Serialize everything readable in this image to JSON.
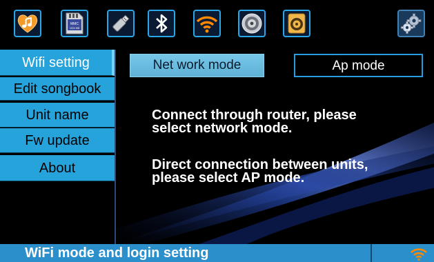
{
  "toolbar": {
    "icons": [
      "music-icon",
      "sd-card-icon",
      "usb-drive-icon",
      "bluetooth-icon",
      "wifi-icon",
      "speaker-icon",
      "sub-speaker-icon",
      "settings-gears-icon"
    ],
    "sd_card_brand": "MMC",
    "sd_card_size": "1024 MB"
  },
  "menu": {
    "items": [
      {
        "label": "Wifi setting",
        "active": true
      },
      {
        "label": "Edit songbook",
        "active": false
      },
      {
        "label": "Unit name",
        "active": false
      },
      {
        "label": "Fw update",
        "active": false
      },
      {
        "label": "About",
        "active": false
      }
    ]
  },
  "tabs": {
    "network_mode": "Net work mode",
    "ap_mode": "Ap mode"
  },
  "content": {
    "router_msg_line1": "Connect through router, please",
    "router_msg_line2": "select network mode.",
    "ap_msg_line1": "Direct connection between units,",
    "ap_msg_line2": "please select AP mode."
  },
  "status": {
    "text": "WiFi mode and login setting",
    "icon": "wifi-status-icon"
  },
  "colors": {
    "accent": "#27a3dc",
    "icon_border": "#2aa7e8",
    "wifi_orange": "#ff8a00"
  }
}
